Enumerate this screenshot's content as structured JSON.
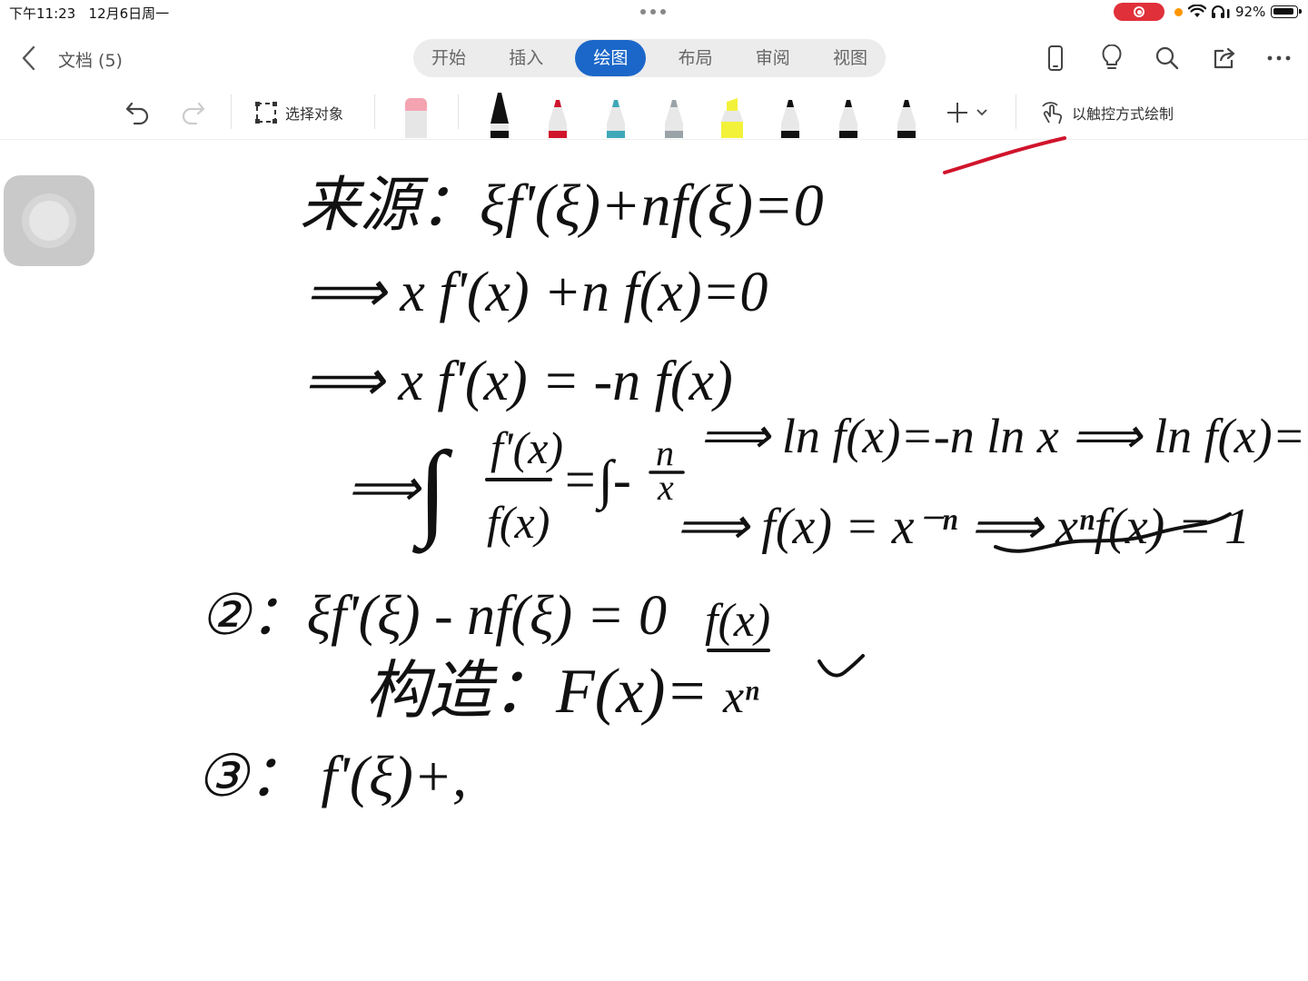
{
  "status_bar": {
    "time": "下午11:23",
    "date": "12月6日周一",
    "battery": "92%"
  },
  "nav": {
    "back_icon": "chevron-left-icon",
    "doc_title": "文档 (5)",
    "tabs": [
      {
        "label": "开始",
        "active": false
      },
      {
        "label": "插入",
        "active": false
      },
      {
        "label": "绘图",
        "active": true
      },
      {
        "label": "布局",
        "active": false
      },
      {
        "label": "审阅",
        "active": false
      },
      {
        "label": "视图",
        "active": false
      }
    ],
    "right_icons": [
      "phone-icon",
      "lightbulb-icon",
      "search-icon",
      "share-icon",
      "more-icon"
    ],
    "accent": "#1b67c9"
  },
  "toolbar": {
    "select_label": "选择对象",
    "touch_draw_label": "以触控方式绘制",
    "pens": [
      {
        "kind": "eraser",
        "color": "#f4a3b0"
      },
      {
        "kind": "pen",
        "color": "#111111"
      },
      {
        "kind": "pen",
        "color": "#d0142c"
      },
      {
        "kind": "pen",
        "color": "#3fa8b8"
      },
      {
        "kind": "pen",
        "color": "#9aa3a8"
      },
      {
        "kind": "highlighter",
        "color": "#f3f23a"
      },
      {
        "kind": "pen",
        "color": "#111111"
      },
      {
        "kind": "pen",
        "color": "#111111"
      },
      {
        "kind": "pen",
        "color": "#111111"
      }
    ]
  },
  "ink_text": {
    "line1": "来源：ξf'(ξ)+nf(ξ)=0",
    "line2": "⟹ x f'(x) +n f(x)=0",
    "line3": "⟹ x f'(x) = -n f(x)",
    "line4a": "⟹ ln f(x)=-n ln x ⟹ ln f(x)=ln x⁻ⁿ",
    "line4_lhs_num": "f'(x)",
    "line4_lhs_den": "f(x)",
    "line4_rhs": "=∫-",
    "line4_rhs_num": "n",
    "line4_rhs_den": "x",
    "line4_arrow": "⟹",
    "line5": "⟹ f(x) = x⁻ⁿ ⟹ xⁿf(x) = 1",
    "line6": "②：ξf'(ξ) - nf(ξ) = 0",
    "line7_label": "构造：F(x)=",
    "line7_num": "f(x)",
    "line7_den": "xⁿ",
    "line8": "③： f'(ξ)+,"
  }
}
